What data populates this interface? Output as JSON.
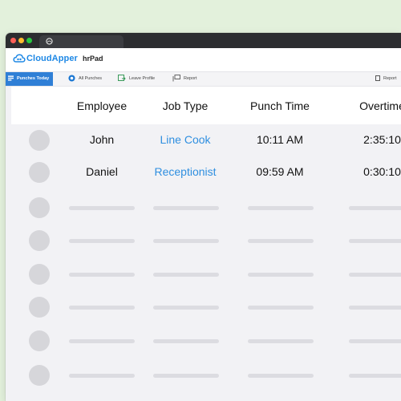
{
  "app": {
    "brand": "CloudApper",
    "name": "hrPad"
  },
  "nav": {
    "items": [
      {
        "label": "Punches Today",
        "active": true
      },
      {
        "label": "All Punches",
        "active": false
      },
      {
        "label": "Leave Profile",
        "active": false
      },
      {
        "label": "Report",
        "active": false
      }
    ],
    "right_item": "Report"
  },
  "table": {
    "columns": [
      "Employee",
      "Job Type",
      "Punch Time",
      "Overtime"
    ],
    "rows": [
      {
        "employee": "John",
        "job_type": "Line Cook",
        "punch_time": "10:11 AM",
        "overtime": "2:35:10"
      },
      {
        "employee": "Daniel",
        "job_type": "Receptionist",
        "punch_time": "09:59 AM",
        "overtime": "0:30:10"
      }
    ],
    "placeholder_rows": 6
  },
  "colors": {
    "brand": "#1e88e5",
    "active_tab": "#2f7fd6",
    "job_type_link": "#2f8fe0",
    "page_background": "#e3f1dc"
  }
}
